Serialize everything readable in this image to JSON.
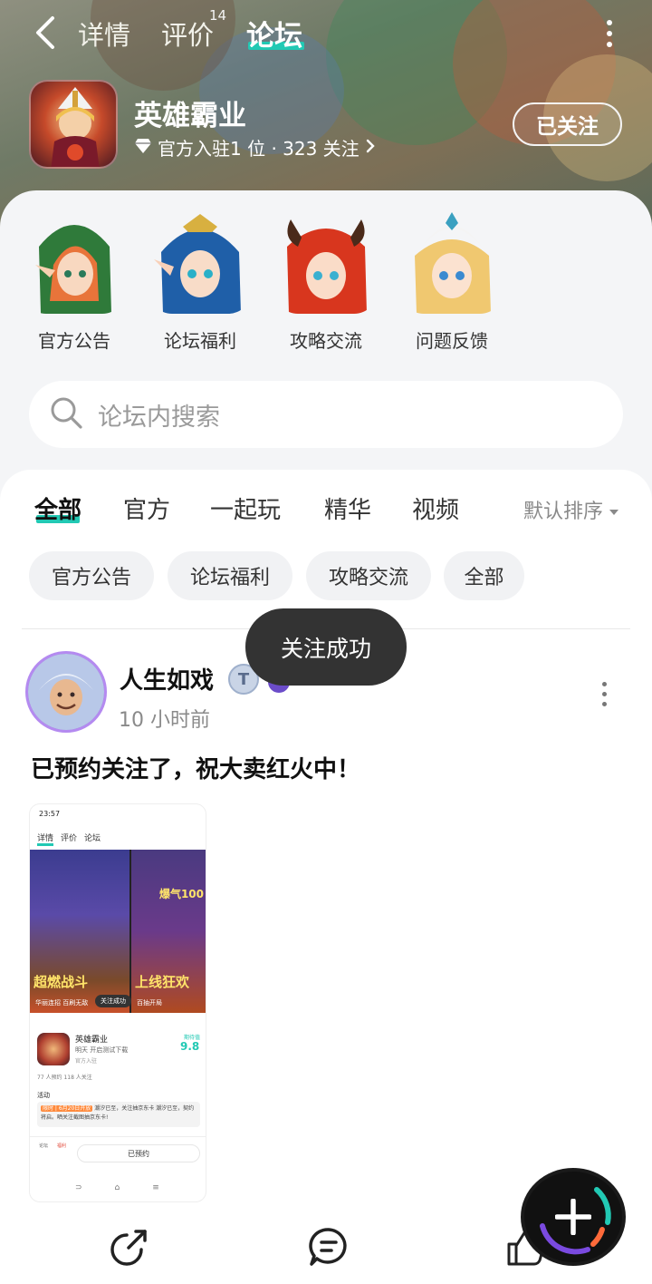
{
  "nav": {
    "tabs": [
      {
        "label": "详情"
      },
      {
        "label": "评价",
        "count": "14"
      },
      {
        "label": "论坛"
      }
    ]
  },
  "game": {
    "name": "英雄霸业",
    "meta": "官方入驻1 位 · 323 关注",
    "follow_label": "已关注"
  },
  "categories": [
    {
      "label": "官方公告"
    },
    {
      "label": "论坛福利"
    },
    {
      "label": "攻略交流"
    },
    {
      "label": "问题反馈"
    }
  ],
  "search": {
    "placeholder": "论坛内搜索"
  },
  "feed_tabs": [
    {
      "label": "全部"
    },
    {
      "label": "官方"
    },
    {
      "label": "一起玩"
    },
    {
      "label": "精华"
    },
    {
      "label": "视频"
    }
  ],
  "sort_label": "默认排序",
  "chips": [
    {
      "label": "官方公告"
    },
    {
      "label": "论坛福利"
    },
    {
      "label": "攻略交流"
    },
    {
      "label": "全部"
    }
  ],
  "toast": "关注成功",
  "post": {
    "author": "人生如戏",
    "time": "10 小时前",
    "text": "已预约关注了，祝大卖红火中！",
    "thumbnail": {
      "status_time": "23:57",
      "nav": [
        "详情",
        "评价",
        "论坛"
      ],
      "caption_left": "超燃战斗",
      "caption_right": "上线狂欢",
      "sub_left": "华丽连招 百刷无敌",
      "sub_right": "百抽开局",
      "luck": "爆气100",
      "toast": "关注成功",
      "app_name": "英雄霸业",
      "app_line": "明天 开启测试下载",
      "app_official": "官方入驻",
      "score_label": "期待值",
      "score": "9.8",
      "stats": "77 人预约    118 人关注",
      "activity": "活动",
      "notice_tag": "限时 | 6月20日开放",
      "notice_text": "潮汐已至，关注抽京东卡 潮汐已至，契约将启。晒关注截图抽京东卡!",
      "bar_left": "论坛",
      "bar_left2": "福利",
      "bar_button": "已预约"
    }
  },
  "colors": {
    "accent": "#22c9b4",
    "toast_bg": "#333333",
    "sheet_bg": "#f4f5f7"
  },
  "icons": [
    "back-arrow-icon",
    "more-icon",
    "diamond-icon",
    "chevron-right-icon",
    "search-icon",
    "caret-down-icon",
    "share-icon",
    "comment-icon",
    "like-icon",
    "plus-icon"
  ]
}
